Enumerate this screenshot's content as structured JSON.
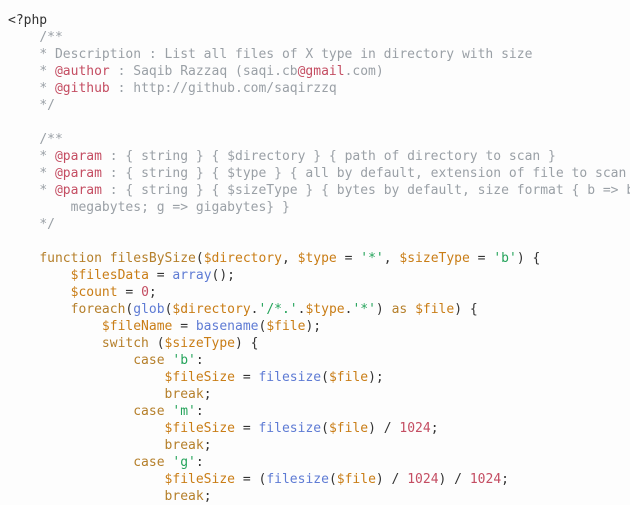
{
  "indent": "    ",
  "lines": [
    {
      "i": 0,
      "tokens": [
        [
          "c-phptag",
          "<?php"
        ]
      ]
    },
    {
      "i": 1,
      "tokens": [
        [
          "c-comment",
          "/**"
        ]
      ]
    },
    {
      "i": 1,
      "tokens": [
        [
          "c-comment",
          "* Description : List all files of X type in directory with size"
        ]
      ]
    },
    {
      "i": 1,
      "tokens": [
        [
          "c-comment",
          "* "
        ],
        [
          "c-dockey",
          "@author"
        ],
        [
          "c-comment",
          " : Saqib Razzaq (saqi.cb"
        ],
        [
          "c-emailish",
          "@gmail"
        ],
        [
          "c-comment",
          ".com)"
        ]
      ]
    },
    {
      "i": 1,
      "tokens": [
        [
          "c-comment",
          "* "
        ],
        [
          "c-dockey",
          "@github"
        ],
        [
          "c-comment",
          " : http://github.com/saqirzzq"
        ]
      ]
    },
    {
      "i": 1,
      "tokens": [
        [
          "c-comment",
          "*/"
        ]
      ]
    },
    {
      "i": 0,
      "tokens": []
    },
    {
      "i": 1,
      "tokens": [
        [
          "c-comment",
          "/**"
        ]
      ]
    },
    {
      "i": 1,
      "tokens": [
        [
          "c-comment",
          "* "
        ],
        [
          "c-dockey",
          "@param"
        ],
        [
          "c-comment",
          " : { string } { $directory } { path of directory to scan }"
        ]
      ]
    },
    {
      "i": 1,
      "tokens": [
        [
          "c-comment",
          "* "
        ],
        [
          "c-dockey",
          "@param"
        ],
        [
          "c-comment",
          " : { string } { $type } { all by default, extension of file to scan"
        ]
      ]
    },
    {
      "i": 1,
      "tokens": [
        [
          "c-comment",
          "* "
        ],
        [
          "c-dockey",
          "@param"
        ],
        [
          "c-comment",
          " : { string } { $sizeType } { bytes by default, size format { b => b"
        ]
      ]
    },
    {
      "i": 2,
      "tokens": [
        [
          "c-comment",
          "megabytes; g => gigabytes} }"
        ]
      ]
    },
    {
      "i": 1,
      "tokens": [
        [
          "c-comment",
          "*/"
        ]
      ]
    },
    {
      "i": 0,
      "tokens": []
    },
    {
      "i": 1,
      "tokens": [
        [
          "c-keyword",
          "function"
        ],
        [
          "c-default",
          " "
        ],
        [
          "c-funcname",
          "filesBySize"
        ],
        [
          "c-default",
          "("
        ],
        [
          "c-var",
          "$directory"
        ],
        [
          "c-default",
          ", "
        ],
        [
          "c-var",
          "$type"
        ],
        [
          "c-default",
          " = "
        ],
        [
          "c-string",
          "'*'"
        ],
        [
          "c-default",
          ", "
        ],
        [
          "c-var",
          "$sizeType"
        ],
        [
          "c-default",
          " = "
        ],
        [
          "c-string",
          "'b'"
        ],
        [
          "c-default",
          ") {"
        ]
      ]
    },
    {
      "i": 2,
      "tokens": [
        [
          "c-var",
          "$filesData"
        ],
        [
          "c-default",
          " = "
        ],
        [
          "c-builtin",
          "array"
        ],
        [
          "c-default",
          "();"
        ]
      ]
    },
    {
      "i": 2,
      "tokens": [
        [
          "c-var",
          "$count"
        ],
        [
          "c-default",
          " = "
        ],
        [
          "c-number",
          "0"
        ],
        [
          "c-default",
          ";"
        ]
      ]
    },
    {
      "i": 2,
      "tokens": [
        [
          "c-keyword",
          "foreach"
        ],
        [
          "c-default",
          "("
        ],
        [
          "c-builtin",
          "glob"
        ],
        [
          "c-default",
          "("
        ],
        [
          "c-var",
          "$directory"
        ],
        [
          "c-default",
          "."
        ],
        [
          "c-string",
          "'/*.'"
        ],
        [
          "c-default",
          "."
        ],
        [
          "c-var",
          "$type"
        ],
        [
          "c-default",
          "."
        ],
        [
          "c-string",
          "'*'"
        ],
        [
          "c-default",
          ") "
        ],
        [
          "c-keyword",
          "as"
        ],
        [
          "c-default",
          " "
        ],
        [
          "c-var",
          "$file"
        ],
        [
          "c-default",
          ") {"
        ]
      ]
    },
    {
      "i": 3,
      "tokens": [
        [
          "c-var",
          "$fileName"
        ],
        [
          "c-default",
          " = "
        ],
        [
          "c-builtin",
          "basename"
        ],
        [
          "c-default",
          "("
        ],
        [
          "c-var",
          "$file"
        ],
        [
          "c-default",
          ");"
        ]
      ]
    },
    {
      "i": 3,
      "tokens": [
        [
          "c-keyword",
          "switch"
        ],
        [
          "c-default",
          " ("
        ],
        [
          "c-var",
          "$sizeType"
        ],
        [
          "c-default",
          ") {"
        ]
      ]
    },
    {
      "i": 4,
      "tokens": [
        [
          "c-keyword",
          "case"
        ],
        [
          "c-default",
          " "
        ],
        [
          "c-string",
          "'b'"
        ],
        [
          "c-default",
          ":"
        ]
      ]
    },
    {
      "i": 5,
      "tokens": [
        [
          "c-var",
          "$fileSize"
        ],
        [
          "c-default",
          " = "
        ],
        [
          "c-builtin",
          "filesize"
        ],
        [
          "c-default",
          "("
        ],
        [
          "c-var",
          "$file"
        ],
        [
          "c-default",
          ");"
        ]
      ]
    },
    {
      "i": 5,
      "tokens": [
        [
          "c-keyword",
          "break"
        ],
        [
          "c-default",
          ";"
        ]
      ]
    },
    {
      "i": 4,
      "tokens": [
        [
          "c-keyword",
          "case"
        ],
        [
          "c-default",
          " "
        ],
        [
          "c-string",
          "'m'"
        ],
        [
          "c-default",
          ":"
        ]
      ]
    },
    {
      "i": 5,
      "tokens": [
        [
          "c-var",
          "$fileSize"
        ],
        [
          "c-default",
          " = "
        ],
        [
          "c-builtin",
          "filesize"
        ],
        [
          "c-default",
          "("
        ],
        [
          "c-var",
          "$file"
        ],
        [
          "c-default",
          ") / "
        ],
        [
          "c-number",
          "1024"
        ],
        [
          "c-default",
          ";"
        ]
      ]
    },
    {
      "i": 5,
      "tokens": [
        [
          "c-keyword",
          "break"
        ],
        [
          "c-default",
          ";"
        ]
      ]
    },
    {
      "i": 4,
      "tokens": [
        [
          "c-keyword",
          "case"
        ],
        [
          "c-default",
          " "
        ],
        [
          "c-string",
          "'g'"
        ],
        [
          "c-default",
          ":"
        ]
      ]
    },
    {
      "i": 5,
      "tokens": [
        [
          "c-var",
          "$fileSize"
        ],
        [
          "c-default",
          " = ("
        ],
        [
          "c-builtin",
          "filesize"
        ],
        [
          "c-default",
          "("
        ],
        [
          "c-var",
          "$file"
        ],
        [
          "c-default",
          ") / "
        ],
        [
          "c-number",
          "1024"
        ],
        [
          "c-default",
          ") / "
        ],
        [
          "c-number",
          "1024"
        ],
        [
          "c-default",
          ";"
        ]
      ]
    },
    {
      "i": 5,
      "tokens": [
        [
          "c-keyword",
          "break"
        ],
        [
          "c-default",
          ";"
        ]
      ]
    }
  ]
}
